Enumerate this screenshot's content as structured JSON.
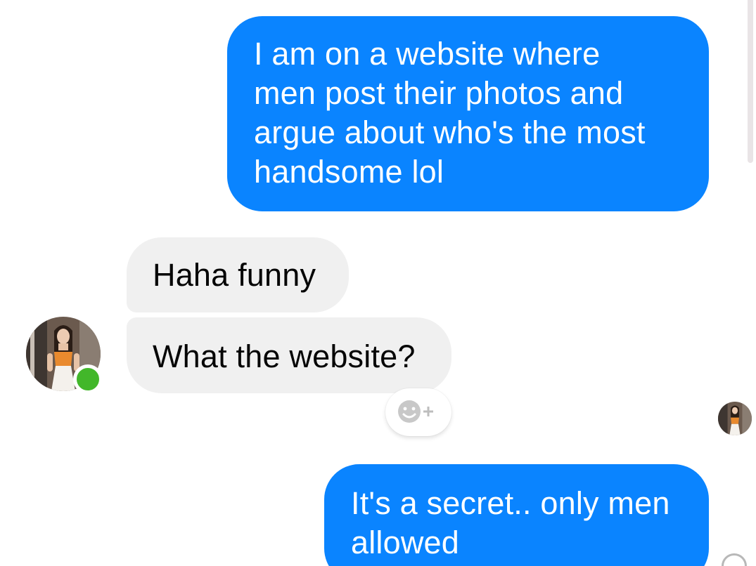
{
  "conversation": {
    "messages": [
      {
        "direction": "sent",
        "text": "I am on a website where\nmen post their photos and\nargue about who's the most\nhandsome lol"
      },
      {
        "direction": "received",
        "text": "Haha funny"
      },
      {
        "direction": "received",
        "text": "What the website?"
      },
      {
        "direction": "sent",
        "text": "It's a secret.. only men\nallowed"
      }
    ]
  },
  "icons": {
    "reaction": "smiley-plus-icon",
    "online": "online-status-dot",
    "delivered": "delivered-check-icon"
  },
  "colors": {
    "sent_bubble": "#0a84ff",
    "received_bubble": "#f0f0f0",
    "online": "#42b72a"
  }
}
